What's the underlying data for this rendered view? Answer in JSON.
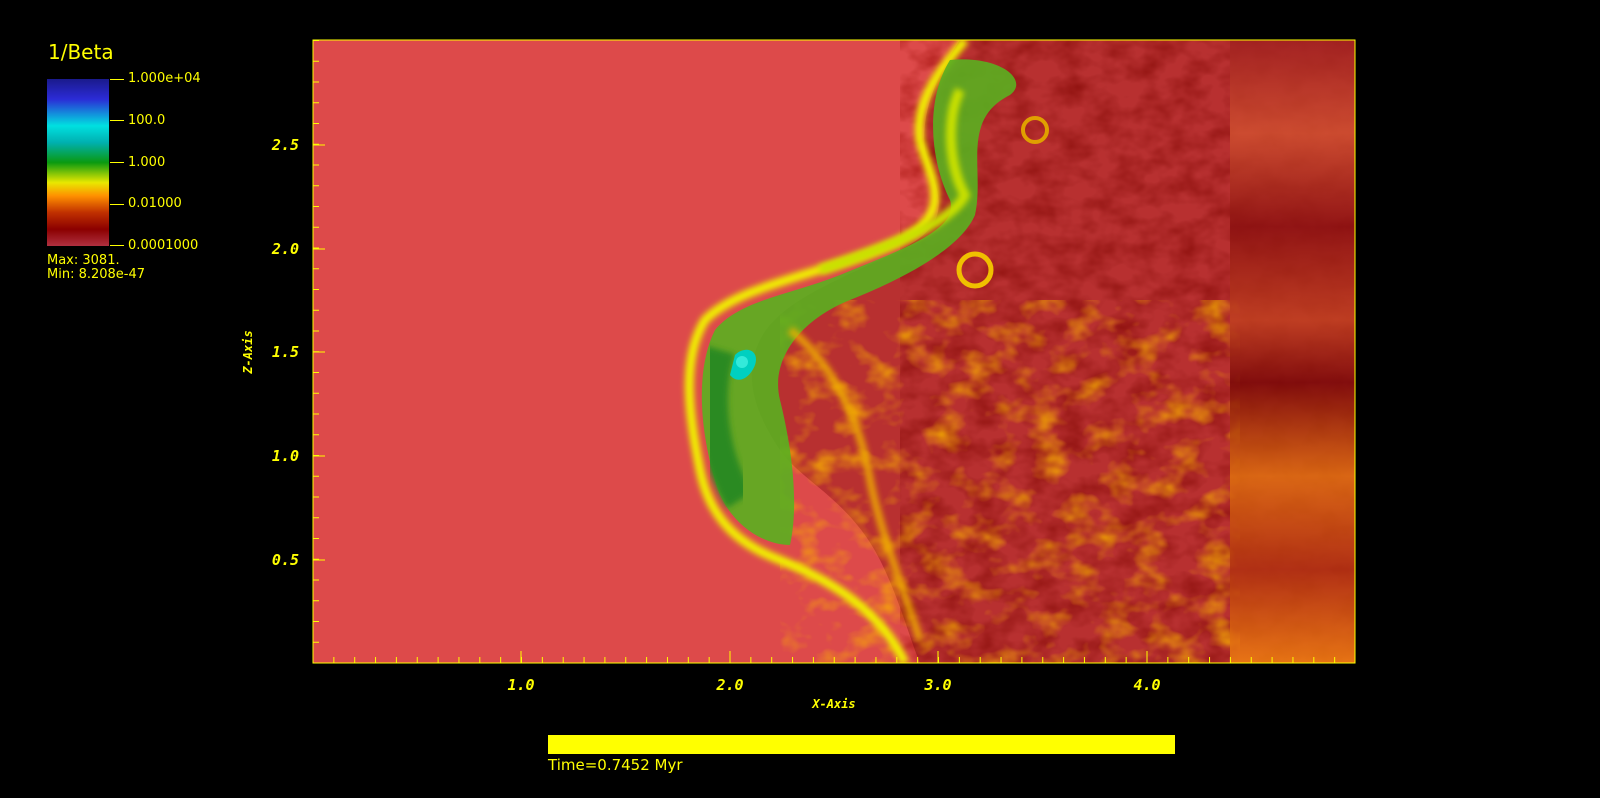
{
  "legend": {
    "title": "1/Beta",
    "ticks": [
      "1.000e+04",
      "100.0",
      "1.000",
      "0.01000",
      "0.0001000"
    ],
    "max": "Max:  3081.",
    "min": "Min:  8.208e-47"
  },
  "axes": {
    "x_label": "X-Axis",
    "y_label": "Z-Axis",
    "x_ticks": [
      "1.0",
      "2.0",
      "3.0",
      "4.0"
    ],
    "y_ticks": [
      "2.5",
      "2.0",
      "1.5",
      "1.0",
      "0.5"
    ]
  },
  "time": {
    "label": "Time=0.7452 Myr",
    "progress": 1.0
  },
  "colors": {
    "background": "#000000",
    "text": "#ffff00",
    "field_base": "#dd4a4a",
    "field_dark": "#8b1010",
    "field_orange": "#e06000",
    "field_yellow": "#f0f000",
    "field_green": "#3aa02a",
    "field_cyan": "#00c0c0"
  }
}
